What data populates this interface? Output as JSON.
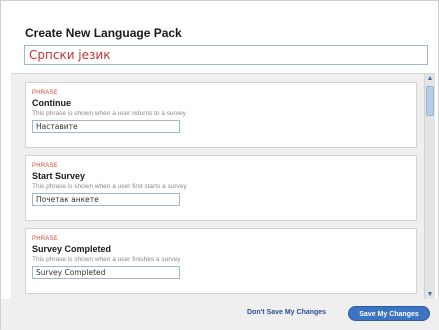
{
  "dialog": {
    "title": "Create New Language Pack",
    "language_name": "Српски језик"
  },
  "phrases": [
    {
      "label": "PHRASE",
      "name": "Continue",
      "description": "This phrase is shown when a user returns to a survey",
      "value": "Наставите"
    },
    {
      "label": "PHRASE",
      "name": "Start Survey",
      "description": "This phrase is shown when a user first starts a survey",
      "value": "Почетак анкете"
    },
    {
      "label": "PHRASE",
      "name": "Survey Completed",
      "description": "This phrase is shown when a user finishes a survey",
      "value": "Survey Completed"
    }
  ],
  "footer": {
    "dont_save_label": "Don't Save My Changes",
    "save_label": "Save My Changes"
  }
}
